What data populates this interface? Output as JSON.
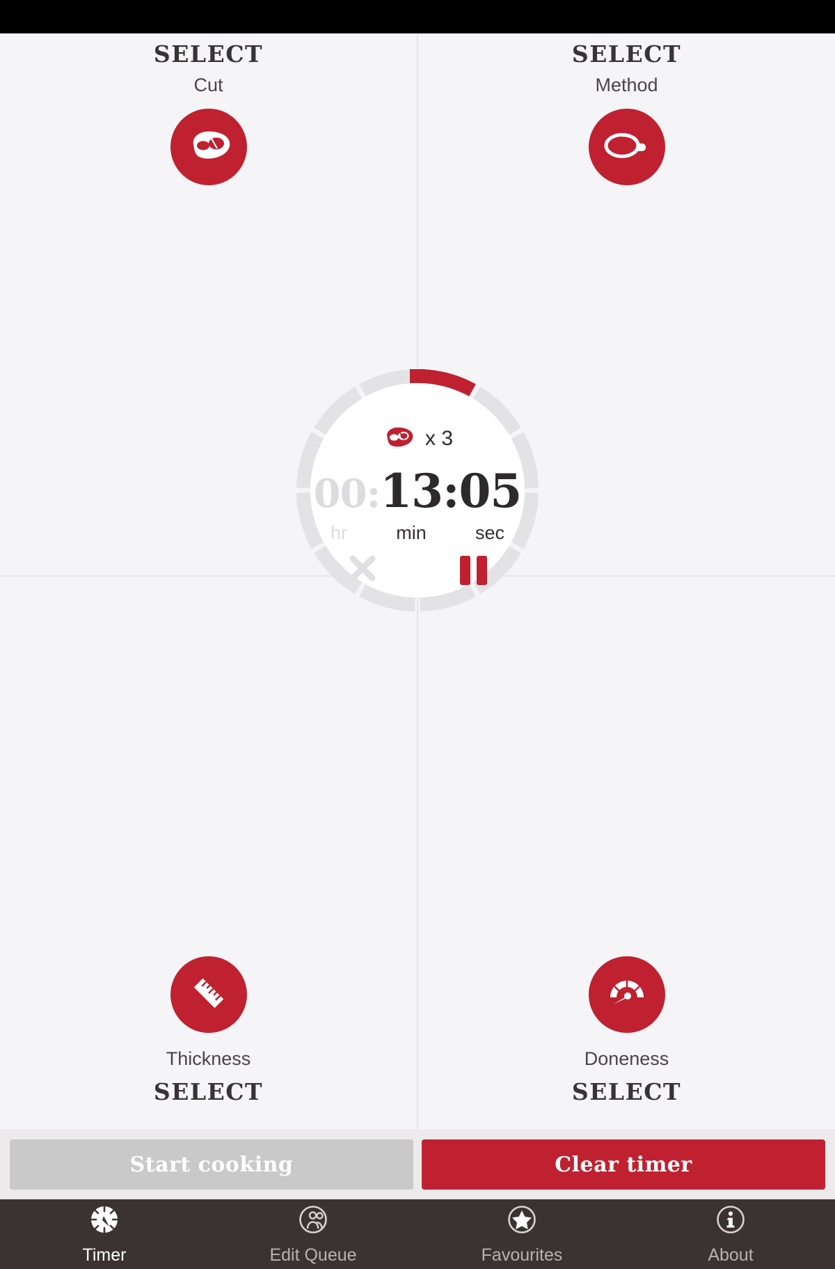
{
  "app": {
    "accent_red": "#bf2130",
    "bg": "#f5f5f7",
    "nav_bg": "#3a3332",
    "disabled_gray": "#c9c9c9"
  },
  "selectors": {
    "cut": {
      "select_label": "SELECT",
      "field_label": "Cut",
      "icon": "steak-icon",
      "order": "select-first"
    },
    "method": {
      "select_label": "SELECT",
      "field_label": "Method",
      "icon": "frying-pan-icon",
      "order": "select-first"
    },
    "thickness": {
      "select_label": "SELECT",
      "field_label": "Thickness",
      "icon": "ruler-icon",
      "order": "icon-first"
    },
    "doneness": {
      "select_label": "SELECT",
      "field_label": "Doneness",
      "icon": "gauge-icon",
      "order": "icon-first"
    }
  },
  "timer": {
    "quantity_icon": "steak-icon",
    "quantity_text": "x 3",
    "hours": "00",
    "sep1": ":",
    "minutes": "13",
    "sep2": ":",
    "seconds": "05",
    "unit_hr": "hr",
    "unit_min": "min",
    "unit_sec": "sec",
    "cancel_icon": "close-icon",
    "pause_icon": "pause-icon",
    "ring_segments": 12,
    "ring_progress_segment": 0,
    "ring_color": "#e3e2e4",
    "ring_active_color": "#bf2130"
  },
  "actions": {
    "start_label": "Start cooking",
    "start_enabled": false,
    "clear_label": "Clear timer",
    "clear_enabled": true
  },
  "nav": {
    "items": [
      {
        "label": "Timer",
        "icon": "stopwatch-icon",
        "active": true
      },
      {
        "label": "Edit Queue",
        "icon": "people-icon",
        "active": false
      },
      {
        "label": "Favourites",
        "icon": "star-icon",
        "active": false
      },
      {
        "label": "About",
        "icon": "info-icon",
        "active": false
      }
    ]
  }
}
